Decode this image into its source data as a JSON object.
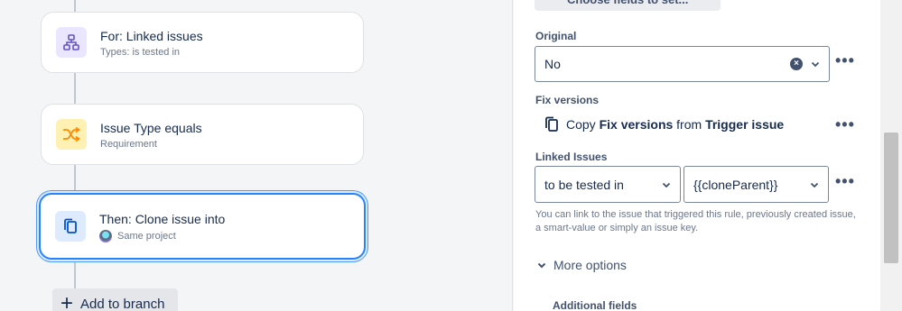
{
  "canvas": {
    "nodes": [
      {
        "title": "For: Linked issues",
        "subtitle": "Types: is tested in",
        "icon": "branch-icon"
      },
      {
        "title": "Issue Type equals",
        "subtitle": "Requirement",
        "icon": "shuffle-icon"
      },
      {
        "title": "Then: Clone issue into",
        "subtitle": "Same project",
        "icon": "copy-icon"
      }
    ],
    "add_branch_label": "Add to branch"
  },
  "panel": {
    "top_button_label": "Choose fields to set...",
    "original": {
      "label": "Original",
      "value": "No"
    },
    "fix_versions": {
      "label": "Fix versions",
      "copy_word": "Copy",
      "field": "Fix versions",
      "from_word": "from",
      "source": "Trigger issue"
    },
    "linked_issues": {
      "label": "Linked Issues",
      "link_type": "to be tested in",
      "target": "{{cloneParent}}",
      "helper": "You can link to the issue that triggered this rule, previously created issue, a smart-value or simply an issue key."
    },
    "more_options_label": "More options",
    "additional_fields_label": "Additional fields",
    "more_actions": "•••"
  },
  "colors": {
    "selected_border": "#2684ff",
    "branch_icon": "#6554c0",
    "condition_icon": "#ff8b00",
    "action_icon": "#0052cc"
  }
}
